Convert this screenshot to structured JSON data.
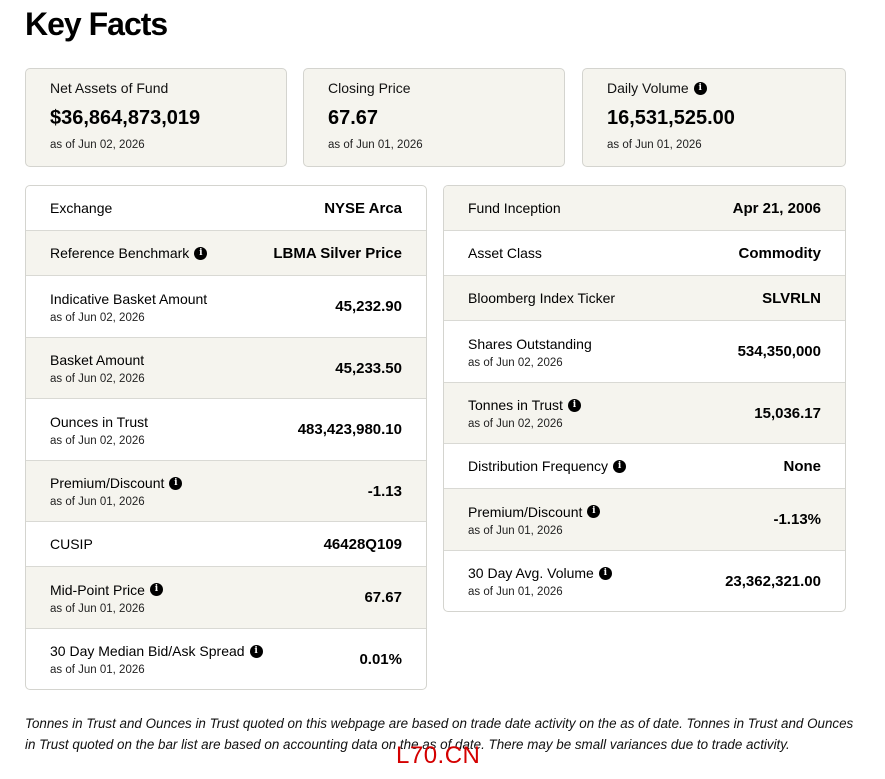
{
  "page": {
    "title": "Key Facts"
  },
  "cards": [
    {
      "label": "Net Assets of Fund",
      "value": "$36,864,873,019",
      "asof": "as of Jun 02, 2026",
      "info": false
    },
    {
      "label": "Closing Price",
      "value": "67.67",
      "asof": "as of Jun 01, 2026",
      "info": false
    },
    {
      "label": "Daily Volume",
      "value": "16,531,525.00",
      "asof": "as of Jun 01, 2026",
      "info": true
    }
  ],
  "left_table": [
    {
      "label": "Exchange",
      "value": "NYSE Arca",
      "asof": "",
      "info": false
    },
    {
      "label": "Reference Benchmark",
      "value": "LBMA Silver Price",
      "asof": "",
      "info": true
    },
    {
      "label": "Indicative Basket Amount",
      "value": "45,232.90",
      "asof": "as of Jun 02, 2026",
      "info": false
    },
    {
      "label": "Basket Amount",
      "value": "45,233.50",
      "asof": "as of Jun 02, 2026",
      "info": false
    },
    {
      "label": "Ounces in Trust",
      "value": "483,423,980.10",
      "asof": "as of Jun 02, 2026",
      "info": false
    },
    {
      "label": "Premium/Discount",
      "value": "-1.13",
      "asof": "as of Jun 01, 2026",
      "info": true
    },
    {
      "label": "CUSIP",
      "value": "46428Q109",
      "asof": "",
      "info": false
    },
    {
      "label": "Mid-Point Price",
      "value": "67.67",
      "asof": "as of Jun 01, 2026",
      "info": true
    },
    {
      "label": "30 Day Median Bid/Ask Spread",
      "value": "0.01%",
      "asof": "as of Jun 01, 2026",
      "info": true
    }
  ],
  "right_table": [
    {
      "label": "Fund Inception",
      "value": "Apr 21, 2006",
      "asof": "",
      "info": false
    },
    {
      "label": "Asset Class",
      "value": "Commodity",
      "asof": "",
      "info": false
    },
    {
      "label": "Bloomberg Index Ticker",
      "value": "SLVRLN",
      "asof": "",
      "info": false
    },
    {
      "label": "Shares Outstanding",
      "value": "534,350,000",
      "asof": "as of Jun 02, 2026",
      "info": false
    },
    {
      "label": "Tonnes in Trust",
      "value": "15,036.17",
      "asof": "as of Jun 02, 2026",
      "info": true
    },
    {
      "label": "Distribution Frequency",
      "value": "None",
      "asof": "",
      "info": true
    },
    {
      "label": "Premium/Discount",
      "value": "-1.13%",
      "asof": "as of Jun 01, 2026",
      "info": true
    },
    {
      "label": "30 Day Avg. Volume",
      "value": "23,362,321.00",
      "asof": "as of Jun 01, 2026",
      "info": true
    }
  ],
  "footnote": "Tonnes in Trust and Ounces in Trust quoted on this webpage are based on trade date activity on the as of date. Tonnes in Trust and Ounces in Trust quoted on the bar list are based on accounting data on the as of date. There may be small variances due to trade activity.",
  "watermark": "L70.CN",
  "info_icon": {
    "name": "info-icon",
    "glyph": "i"
  },
  "colors": {
    "card_bg": "#f5f4ee",
    "border": "#d4d4cf",
    "watermark": "#d40000"
  }
}
